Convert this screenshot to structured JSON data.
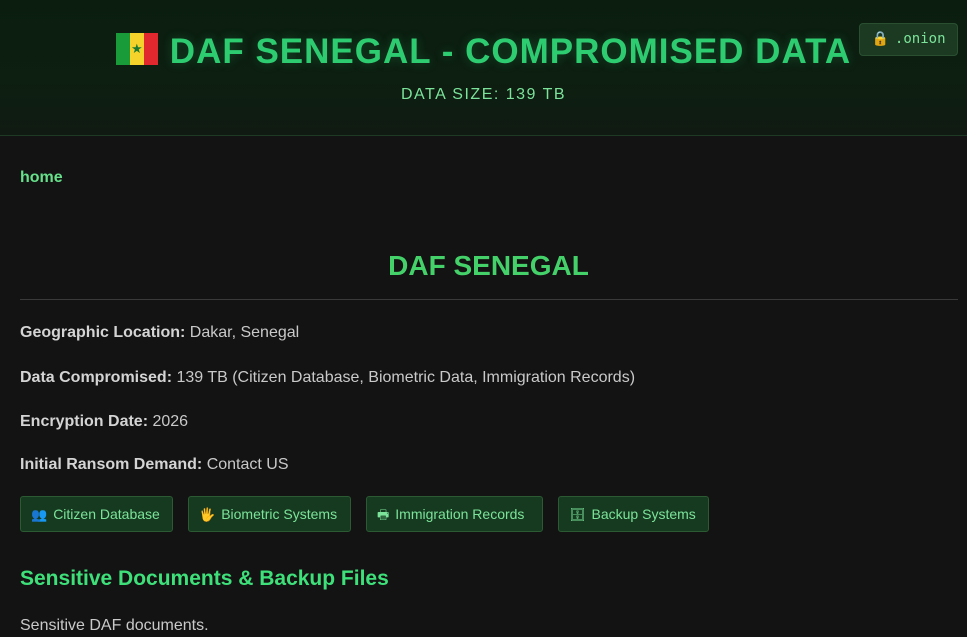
{
  "header": {
    "flag_icon": "senegal-flag-icon",
    "title": "DAF SENEGAL - COMPROMISED DATA",
    "subtitle": "DATA SIZE: 139 TB",
    "onion_badge": {
      "icon": "lock-icon",
      "label": ".onion"
    }
  },
  "nav": {
    "home_label": "home"
  },
  "main": {
    "org_title": "DAF SENEGAL",
    "info": [
      {
        "label": "Geographic Location:",
        "value": "Dakar, Senegal"
      },
      {
        "label": "Data Compromised:",
        "value": "139 TB (Citizen Database, Biometric Data, Immigration Records)"
      },
      {
        "label": "Encryption Date:",
        "value": "2026"
      },
      {
        "label": "Initial Ransom Demand:",
        "value": "Contact US"
      }
    ],
    "tags": [
      {
        "icon": "people-icon",
        "label": "Citizen Database"
      },
      {
        "icon": "hand-icon",
        "label": "Biometric Systems"
      },
      {
        "icon": "printer-icon",
        "label": "Immigration Records"
      },
      {
        "icon": "file-cabinet-icon",
        "label": "Backup Systems"
      }
    ],
    "section_title": "Sensitive Documents & Backup Files",
    "section_text": "Sensitive DAF documents."
  },
  "colors": {
    "accent": "#2ecc71",
    "background": "#131313",
    "tag_background": "#163a1f"
  }
}
